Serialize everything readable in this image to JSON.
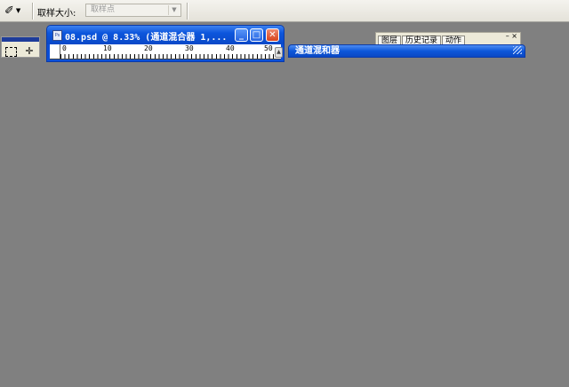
{
  "options_bar": {
    "tool_icon": "eyedropper-icon",
    "sample_size_label": "取样大小:",
    "sample_size_value": "取样点"
  },
  "toolbox": {
    "tools": [
      "rectangular-marquee-icon",
      "move-tool-icon"
    ]
  },
  "document": {
    "title": "08.psd @ 8.33% (通道混合器 1,...",
    "ruler_ticks": [
      "0",
      "10",
      "20",
      "30",
      "40",
      "50"
    ]
  },
  "palette_group": {
    "tabs": [
      "图层",
      "历史记录",
      "动作"
    ],
    "close_glyph": "– ×"
  },
  "channel_mixer": {
    "title": "通道混和器"
  },
  "colors": {
    "workspace": "#808080",
    "titlebar_blue": "#0c55dc",
    "close_red": "#d8441c"
  }
}
